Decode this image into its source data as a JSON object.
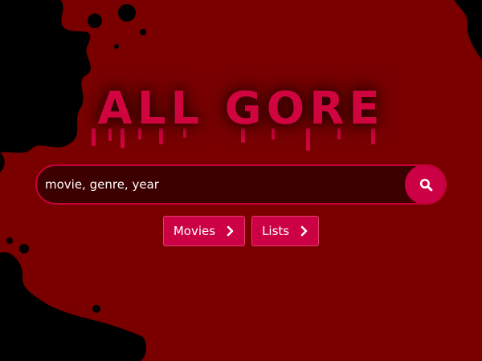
{
  "logo": {
    "text": "ALL GORE"
  },
  "search": {
    "placeholder": "movie, genre, year",
    "button_icon": "search-icon"
  },
  "nav": {
    "buttons": [
      {
        "label": "Movies",
        "icon": "chevron-right-icon"
      },
      {
        "label": "Lists",
        "icon": "chevron-right-icon"
      }
    ]
  },
  "colors": {
    "background": "#7a0000",
    "splatter": "#000000",
    "accent": "#cc0044",
    "search_field": "#3d0000"
  }
}
